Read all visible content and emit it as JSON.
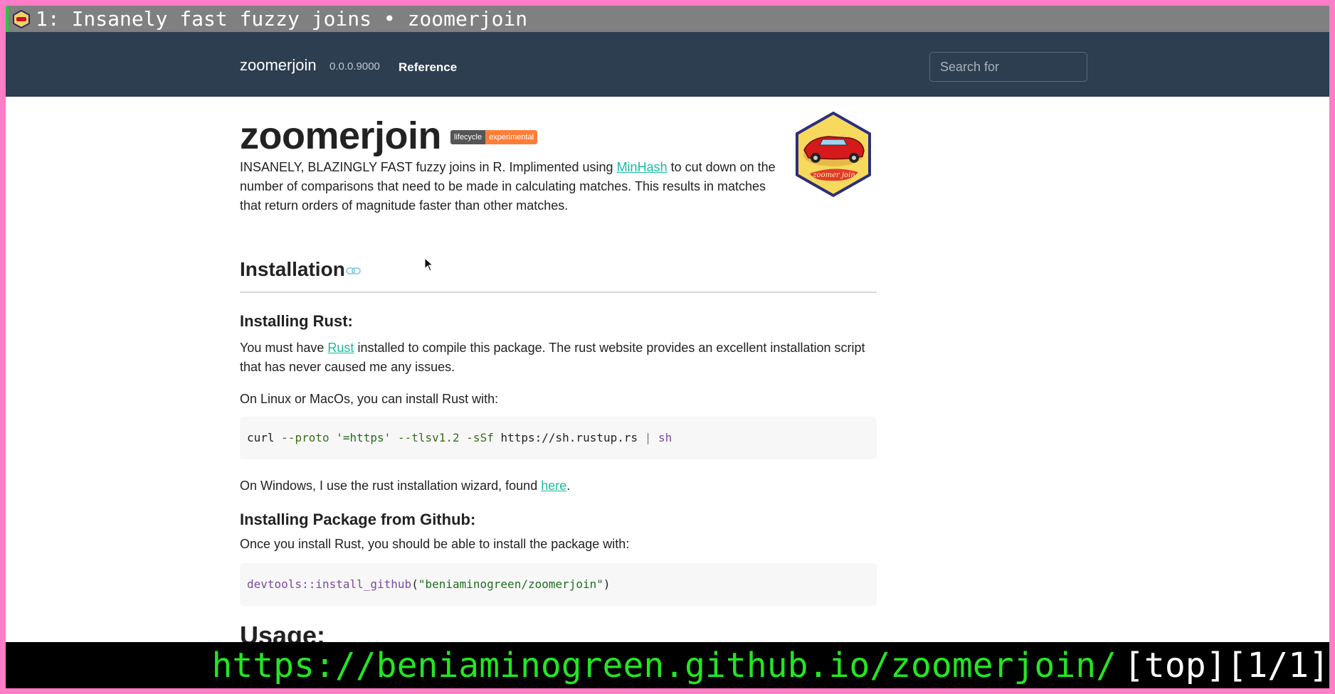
{
  "browser": {
    "tab_title": "1: Insanely fast fuzzy joins • zoomerjoin",
    "status_url": "https://beniaminogreen.github.io/zoomerjoin/",
    "status_position": "[top][1/1]"
  },
  "navbar": {
    "brand": "zoomerjoin",
    "version": "0.0.0.9000",
    "reference_link": "Reference",
    "search_placeholder": "Search for"
  },
  "page": {
    "title": "zoomerjoin",
    "badge_left": "lifecycle",
    "badge_right": "experimental",
    "logo_text": "zoomer join",
    "intro_before": "INSANELY, BLAZINGLY FAST fuzzy joins in R. Implimented using ",
    "intro_link": "MinHash",
    "intro_after": " to cut down on the number of comparisons that need to be made in calculating matches. This results in matches that return orders of magnitude faster than other matches.",
    "installation_heading": "Installation",
    "installing_rust_heading": "Installing Rust:",
    "rust_para_before": "You must have ",
    "rust_link": "Rust",
    "rust_para_after": " installed to compile this package. The rust website provides an excellent installation script that has never caused me any issues.",
    "linux_para": "On Linux or MacOs, you can install Rust with:",
    "code1": {
      "cmd": "curl",
      "flag1": "--proto",
      "str1": "'=https'",
      "flag2": "--tlsv1.2",
      "flag3": "-sSf",
      "url": "https://sh.rustup.rs",
      "pipe": "|",
      "sh": "sh"
    },
    "windows_before": "On Windows, I use the rust installation wizard, found ",
    "windows_link": "here",
    "windows_after": ".",
    "installing_pkg_heading": "Installing Package from Github:",
    "pkg_para": "Once you install Rust, you should be able to install the package with:",
    "code2": {
      "fn": "devtools::install_github",
      "open": "(",
      "arg": "\"beniaminogreen/zoomerjoin\"",
      "close": ")"
    },
    "usage_heading": "Usage:"
  },
  "colors": {
    "navbar_bg": "#2c3e50",
    "link": "#18bc9c",
    "badge_grey": "#555555",
    "badge_orange": "#fe7d37",
    "frame_border": "#ff7cc6"
  }
}
